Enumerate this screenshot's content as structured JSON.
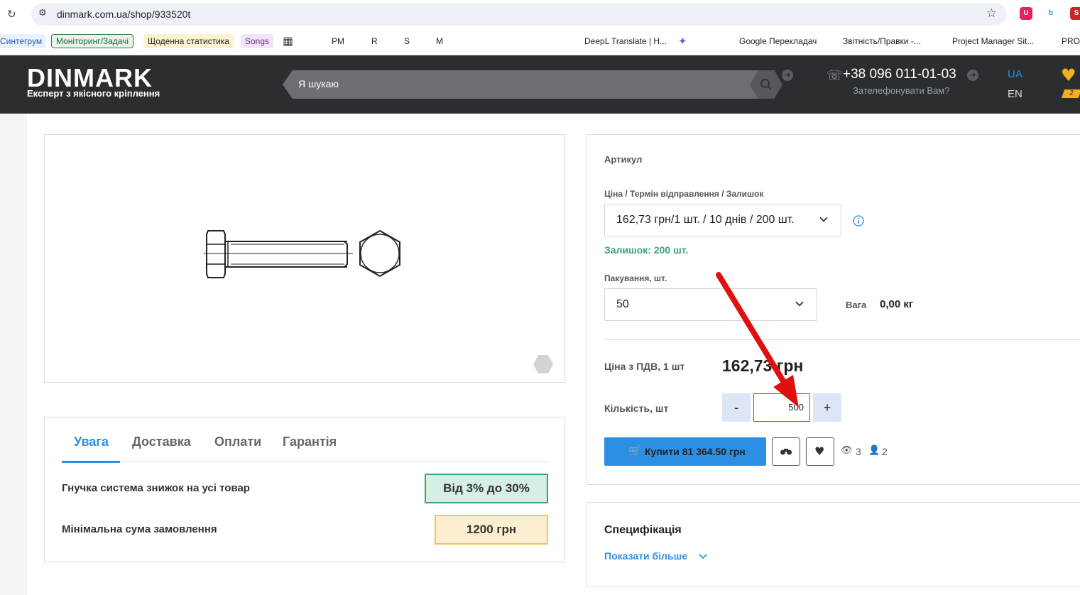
{
  "browser": {
    "url": "dinmark.com.ua/shop/933520t",
    "bookmarks": [
      {
        "label": "Синтегрум",
        "style": "pill-blue"
      },
      {
        "label": "Моніторинг/Задачі",
        "style": "pill-green"
      },
      {
        "label": "Щоденна статистика",
        "style": "pill-yellow"
      },
      {
        "label": "Songs",
        "style": "pill-purple"
      },
      {
        "label": "PM"
      },
      {
        "label": "R"
      },
      {
        "label": "S"
      },
      {
        "label": "M"
      },
      {
        "label": "DeepL Translate | H..."
      },
      {
        "label": "Google Перекладач"
      },
      {
        "label": "Звітність/Правки -..."
      },
      {
        "label": "Project Manager Sit..."
      },
      {
        "label": "PROJ"
      }
    ]
  },
  "header": {
    "logo": "DINMARK",
    "tagline": "Експерт з якісного кріплення",
    "search_placeholder": "Я шукаю",
    "phone": "+38 096 011-01-03",
    "callback": "Зателефонувати Вам?",
    "lang_ua": "UA",
    "lang_en": "EN",
    "wishlist_count": "2"
  },
  "info_tabs": {
    "tabs": [
      "Увага",
      "Доставка",
      "Оплати",
      "Гарантія"
    ],
    "discount_text": "Гнучка система знижок на усі товар",
    "discount_badge": "Від 3% до 30%",
    "min_order_text": "Мінімальна сума замовлення",
    "min_order_badge": "1200 грн"
  },
  "product": {
    "article_label": "Артикул",
    "price_term_label": "Ціна / Термін відправлення / Залишок",
    "price_term_value": "162,73 грн/1 шт. / 10 днів / 200 шт.",
    "stock": "Залишок: 200 шт.",
    "packaging_label": "Пакування, шт.",
    "packaging_value": "50",
    "weight_label": "Вага",
    "weight_value": "0,00 кг",
    "price_vat_label": "Ціна з ПДВ, 1 шт",
    "price_vat_value": "162,73 грн",
    "qty_label": "Кількість, шт",
    "qty_minus": "-",
    "qty_value": "500",
    "qty_plus": "+",
    "buy_label": "Купити 81 364.50 грн",
    "views": "3",
    "users": "2"
  },
  "spec": {
    "title": "Специфікація",
    "more": "Показати більше"
  },
  "colors": {
    "accent": "#2d8fe3",
    "header_bg": "#2b2e31",
    "stock_green": "#3aa47a",
    "annotation_red": "#e01010"
  }
}
